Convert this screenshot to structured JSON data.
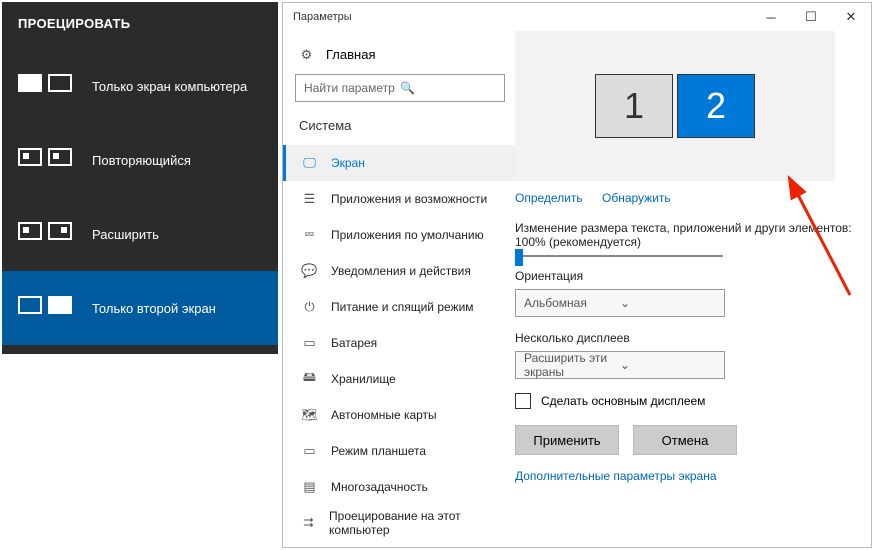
{
  "project_panel": {
    "title": "ПРОЕЦИРОВАТЬ",
    "items": [
      {
        "label": "Только экран компьютера"
      },
      {
        "label": "Повторяющийся"
      },
      {
        "label": "Расширить"
      },
      {
        "label": "Только второй экран"
      }
    ],
    "active_index": 3
  },
  "settings": {
    "window_title": "Параметры",
    "home_label": "Главная",
    "search_placeholder": "Найти параметр",
    "category": "Система",
    "nav": [
      "Экран",
      "Приложения и возможности",
      "Приложения по умолчанию",
      "Уведомления и действия",
      "Питание и спящий режим",
      "Батарея",
      "Хранилище",
      "Автономные карты",
      "Режим планшета",
      "Многозадачность",
      "Проецирование на этот компьютер"
    ],
    "selected_nav_index": 0,
    "displays": {
      "first": "1",
      "second": "2"
    },
    "link_identify": "Определить",
    "link_detect": "Обнаружить",
    "scale_label": "Изменение размера текста, приложений и други элементов: 100% (рекомендуется)",
    "orientation_label": "Ориентация",
    "orientation_value": "Альбомная",
    "multi_label": "Несколько дисплеев",
    "multi_value": "Расширить эти экраны",
    "make_main_label": "Сделать основным дисплеем",
    "apply_label": "Применить",
    "cancel_label": "Отмена",
    "extra_link": "Дополнительные параметры экрана"
  }
}
